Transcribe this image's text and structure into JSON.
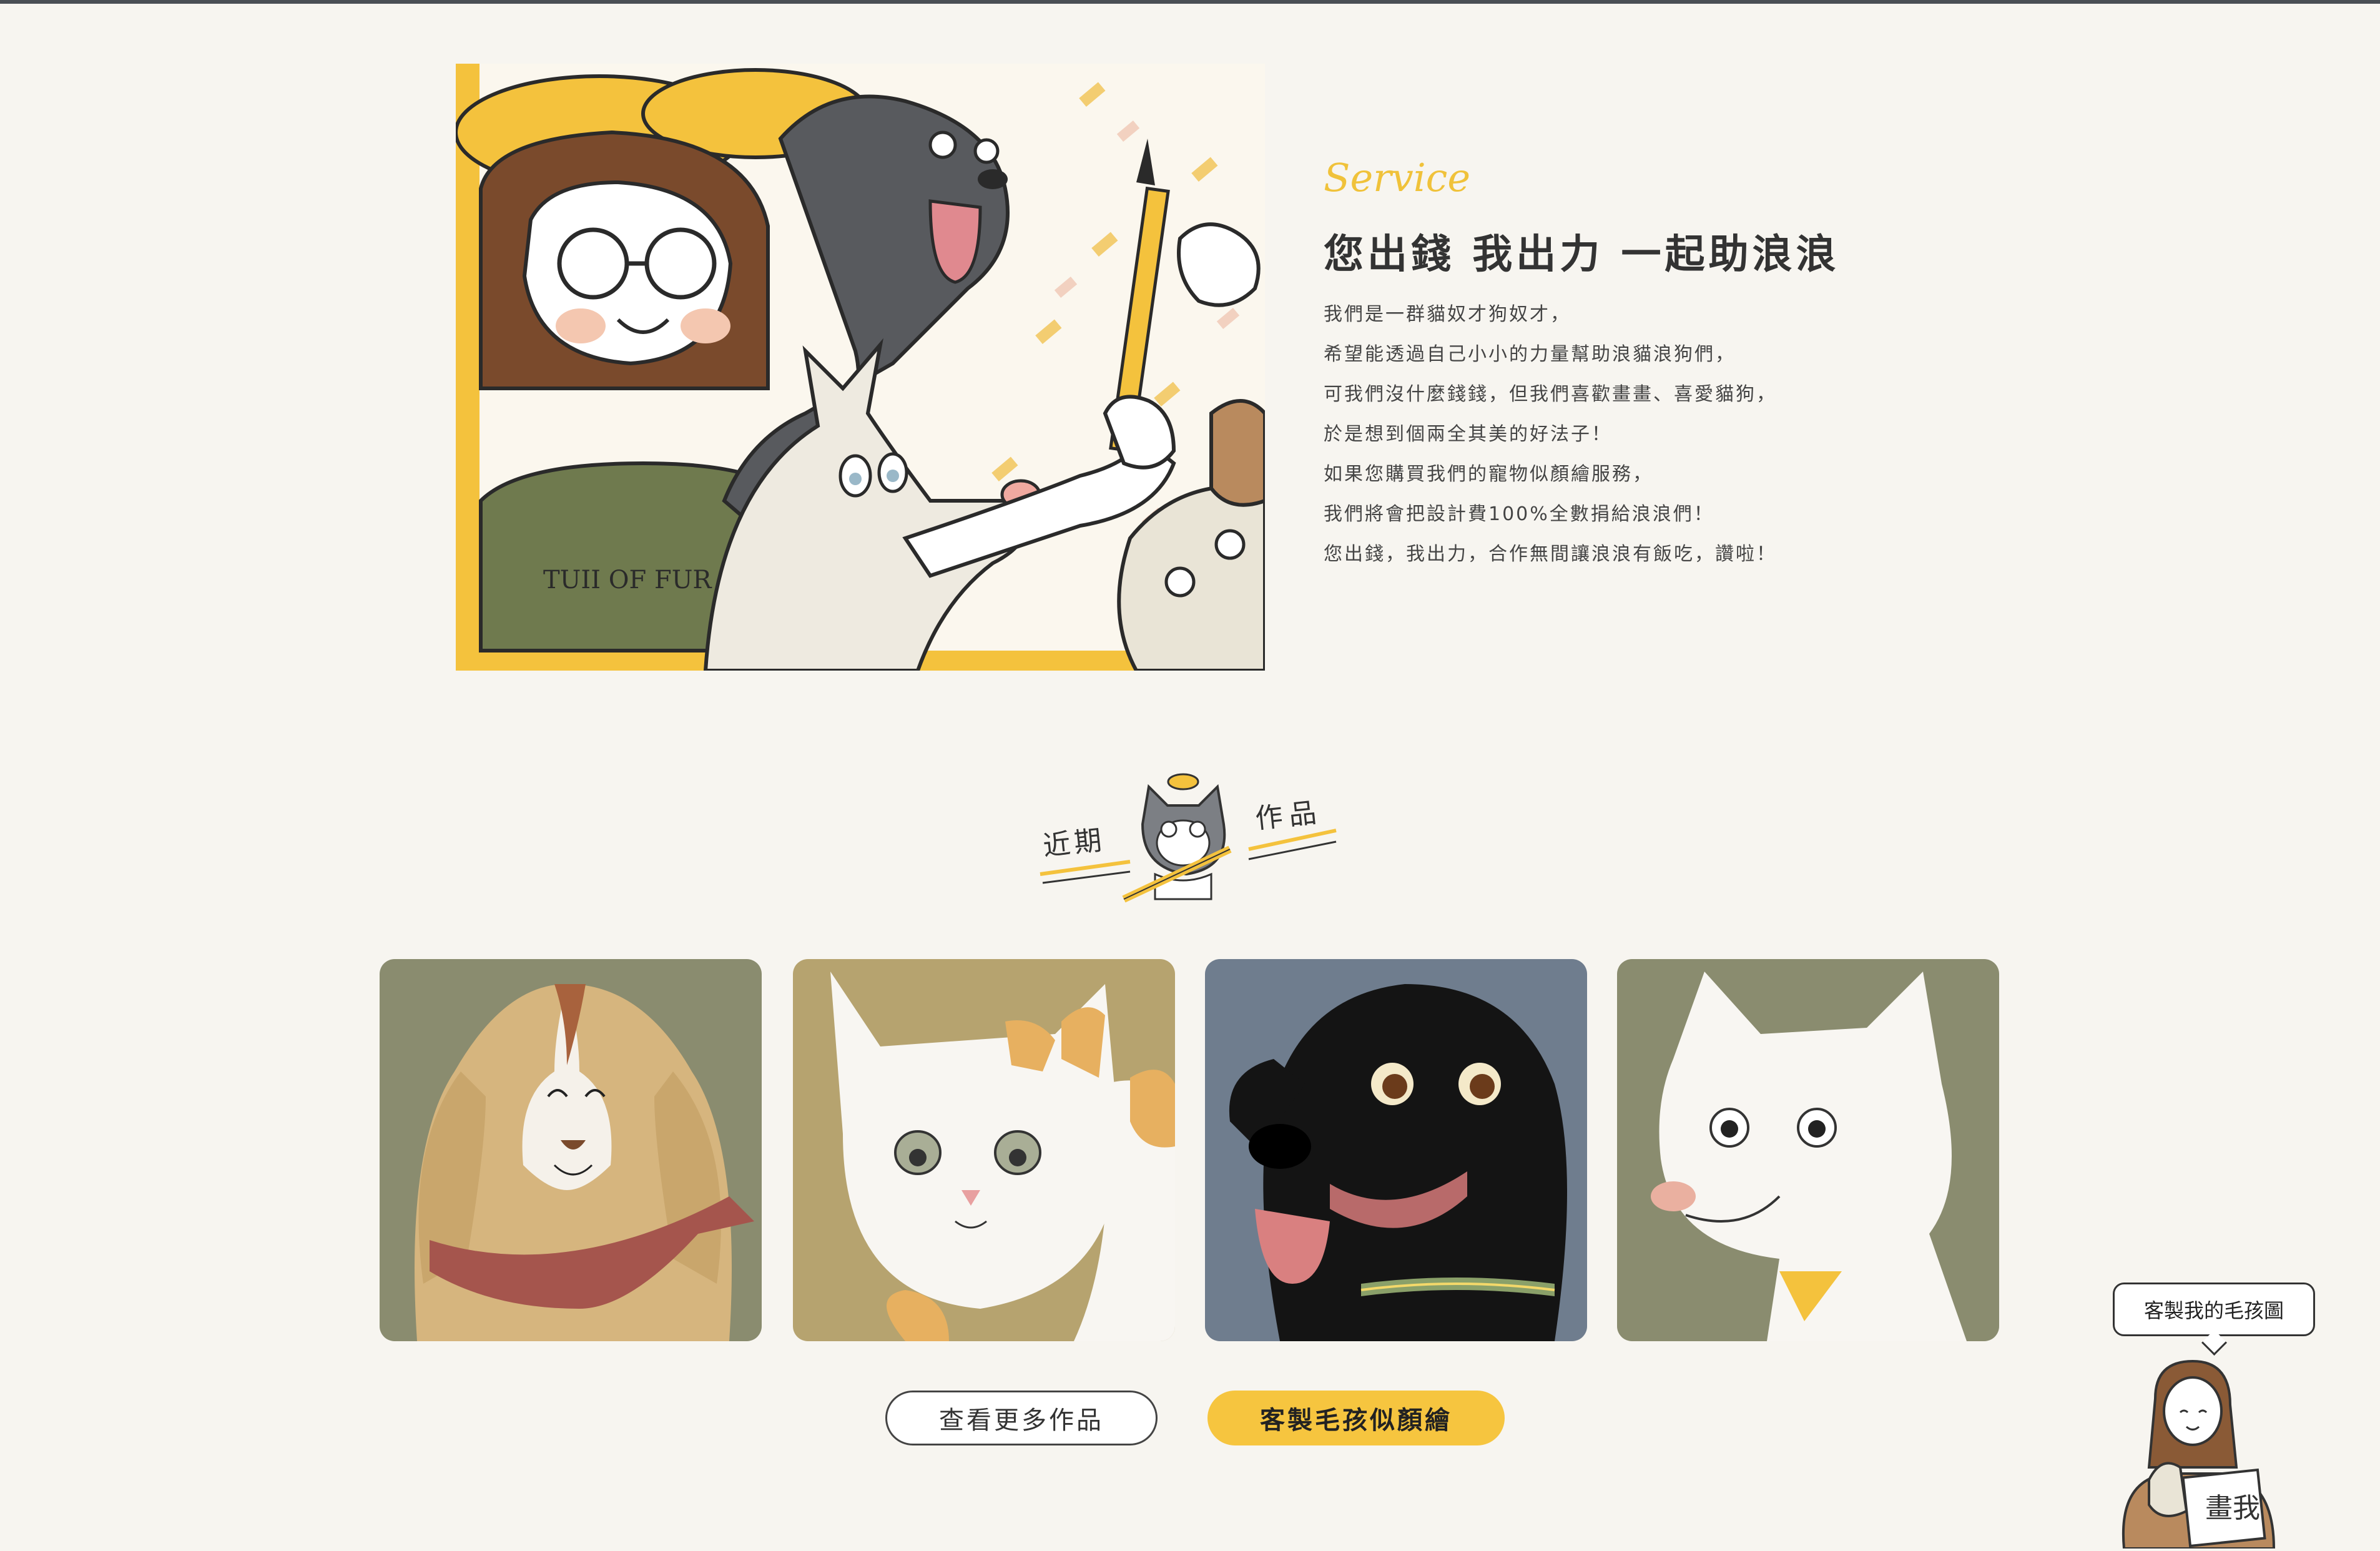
{
  "service": {
    "label": "Service",
    "title": "您出錢 我出力 一起助浪浪",
    "lines": [
      "我們是一群貓奴才狗奴才，",
      "希望能透過自己小小的力量幫助浪貓浪狗們，",
      "可我們沒什麼錢錢，但我們喜歡畫畫、喜愛貓狗，",
      "於是想到個兩全其美的好法子！",
      "如果您購買我們的寵物似顏繪服務，",
      "我們將會把設計費100%全數捐給浪浪們！",
      "您出錢，我出力，合作無間讓浪浪有飯吃，讚啦！"
    ]
  },
  "hero": {
    "shirt_text": "TUII OF FUR"
  },
  "recent_works": {
    "left_text": "近期",
    "right_text": "作品"
  },
  "gallery": [
    {
      "name": "golden-dog",
      "bg": "#8a8c6f"
    },
    {
      "name": "calico-cat",
      "bg": "#b6a36f"
    },
    {
      "name": "black-dog",
      "bg": "#6f7d8e"
    },
    {
      "name": "white-dog",
      "bg": "#8a8c6f"
    }
  ],
  "buttons": {
    "more_works": "查看更多作品",
    "custom": "客製毛孩似顏繪"
  },
  "widget": {
    "bubble_text": "客製我的毛孩圖",
    "sign_text": "畫我"
  },
  "colors": {
    "accent": "#f6c53f",
    "background": "#f7f5f0",
    "text": "#333333"
  }
}
